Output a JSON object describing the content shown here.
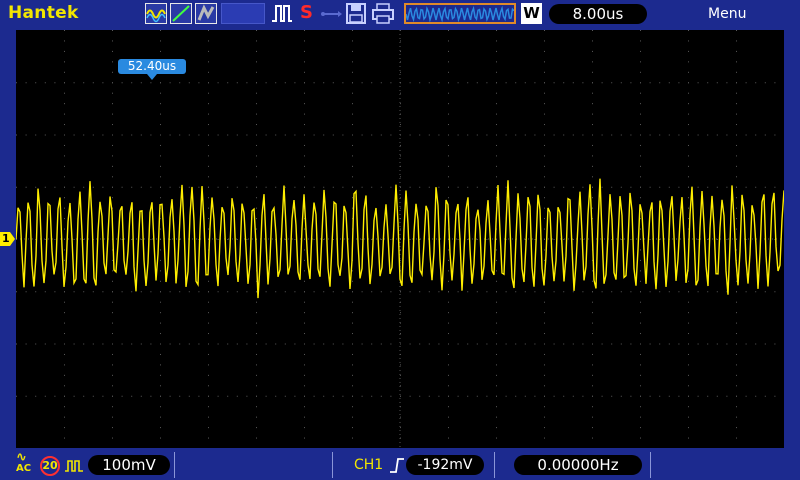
{
  "header": {
    "brand": "Hantek",
    "run_state": "S",
    "window_mode": "W",
    "timebase": "8.00us",
    "menu_label": "Menu"
  },
  "screen": {
    "trigger_position": "52.40us",
    "channel_marker": "1"
  },
  "footer": {
    "coupling_top": "∿",
    "coupling_bottom": "AC",
    "bandwidth_limit": "20",
    "volt_scale": "100mV",
    "trigger_source": "CH1",
    "trigger_level": "-192mV",
    "frequency": "0.00000Hz"
  },
  "colors": {
    "background": "#1c2a8f",
    "screen": "#000000",
    "trace": "#ffee00",
    "brand": "#f2e600",
    "accent_blue": "#2a8ae0",
    "stop_red": "#ff2a2a"
  }
}
